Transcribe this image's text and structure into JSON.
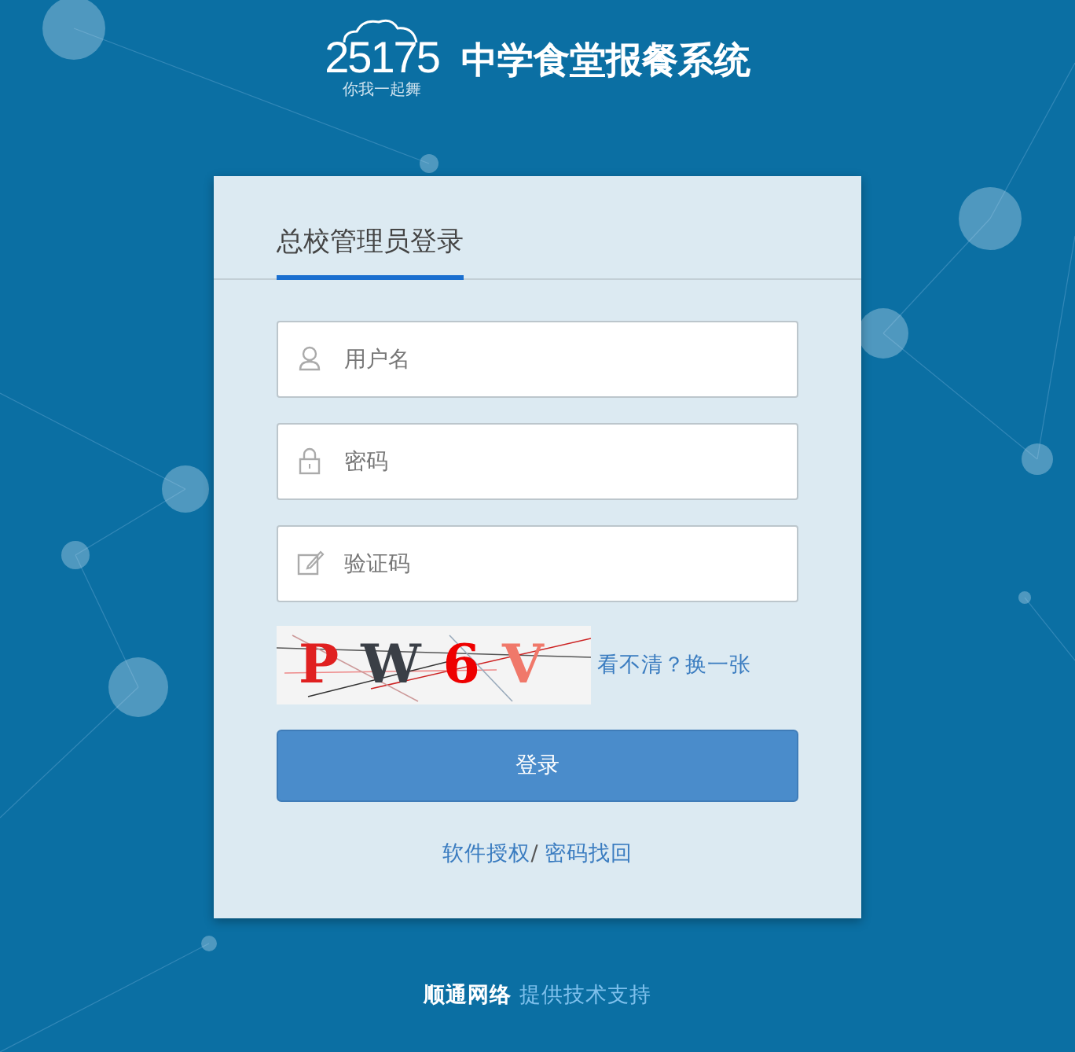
{
  "logo": {
    "mark": "25175",
    "tagline": "你我一起舞"
  },
  "app_title": "中学食堂报餐系统",
  "login_card": {
    "tabs": [
      {
        "label": "总校管理员登录",
        "selected": true
      }
    ],
    "fields": [
      {
        "kind": "user",
        "placeholder": "用户名"
      },
      {
        "kind": "lock",
        "placeholder": "密码"
      },
      {
        "kind": "edit",
        "placeholder": "验证码"
      }
    ],
    "captcha": {
      "chars": [
        {
          "text": "P",
          "color": "#e02020"
        },
        {
          "text": "W",
          "color": "#3a3f46"
        },
        {
          "text": "6",
          "color": "#ee0000"
        },
        {
          "text": "V",
          "color": "#f0786a"
        }
      ],
      "refresh_link": "看不清？换一张"
    },
    "login_button": "登录",
    "links": [
      "软件授权",
      "密码找回"
    ],
    "link_separator": "/"
  },
  "footer": {
    "company": "顺通网络",
    "text": "提供技术支持"
  }
}
